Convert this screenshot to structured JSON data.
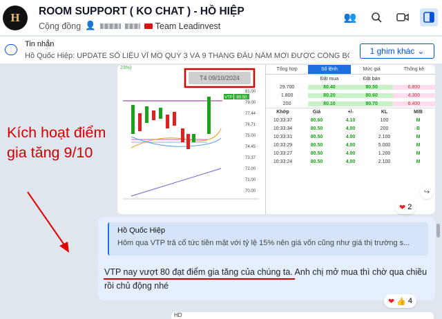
{
  "header": {
    "avatar_text": "H",
    "title": "ROOM SUPPORT ( KO CHAT ) - HỒ HIỆP",
    "type": "Cộng đồng",
    "team": "Team Leadinvest",
    "icons": [
      "group-icon",
      "search-icon",
      "video-icon",
      "sidebar-toggle-icon"
    ]
  },
  "pinned": {
    "label": "Tin nhắn",
    "text": "Hồ Quốc Hiệp: UPDATE SỐ LIỆU VĨ MÔ QUÝ 3 VÀ 9 THÁNG ĐẦU NĂM MỚI ĐƯỢC CÔNG BỐ: + GD...",
    "button": "1 ghim khác"
  },
  "screenshot": {
    "date_label": "T4 09/10/2024",
    "annotation_line1": "Kích hoạt điểm",
    "annotation_line2": "gia tăng 9/10",
    "pct": "23%)",
    "ticker_tag": "VTP",
    "price_tag": "80.50",
    "price_labels": [
      "81.00",
      "79.00",
      "77.44",
      "76.71",
      "75.00",
      "74.45",
      "73.37",
      "72.00",
      "71.00",
      "70.00"
    ],
    "tabs": [
      "Tổng hợp",
      "Sổ lệnh",
      "Mức giá",
      "Thống kê"
    ],
    "orderbook_head": [
      "",
      "Đặt mua",
      "Đặt bán",
      ""
    ],
    "orderbook": [
      [
        "29.700",
        "80.40",
        "80.50",
        "6.800"
      ],
      [
        "1.800",
        "80.20",
        "80.60",
        "4.300"
      ],
      [
        "200",
        "80.10",
        "80.70",
        "6.400"
      ]
    ],
    "trades_head": [
      "Khớp",
      "Giá",
      "+/-",
      "KL",
      "M/B"
    ],
    "trades": [
      [
        "10:33:37",
        "80.60",
        "4.10",
        "100",
        "M"
      ],
      [
        "10:33:34",
        "80.50",
        "4.00",
        "200",
        "B"
      ],
      [
        "10:33:31",
        "80.50",
        "4.00",
        "2.100",
        "M"
      ],
      [
        "10:33:29",
        "80.50",
        "4.00",
        "5.000",
        "M"
      ],
      [
        "10:33:27",
        "80.50",
        "4.00",
        "1.200",
        "M"
      ],
      [
        "10:33:24",
        "80.50",
        "4.00",
        "2.100",
        "M"
      ]
    ],
    "reactions": "2"
  },
  "message": {
    "quote_name": "Hồ Quốc Hiệp",
    "quote_text": "Hôm qua VTP trả cổ tức tiền mặt với tỷ lệ 15% nên giá vốn cũng như giá thị trường s...",
    "text": "VTP nay vượt 80 đạt điểm gia tăng của chúng ta. Anh chị mở mua thì chờ qua chiều rồi chủ động nhé",
    "reactions": "4"
  },
  "next": {
    "label": "HD"
  },
  "colors": {
    "accent": "#0050d8",
    "annotation": "#d40000",
    "message_bg": "#e5efff"
  }
}
